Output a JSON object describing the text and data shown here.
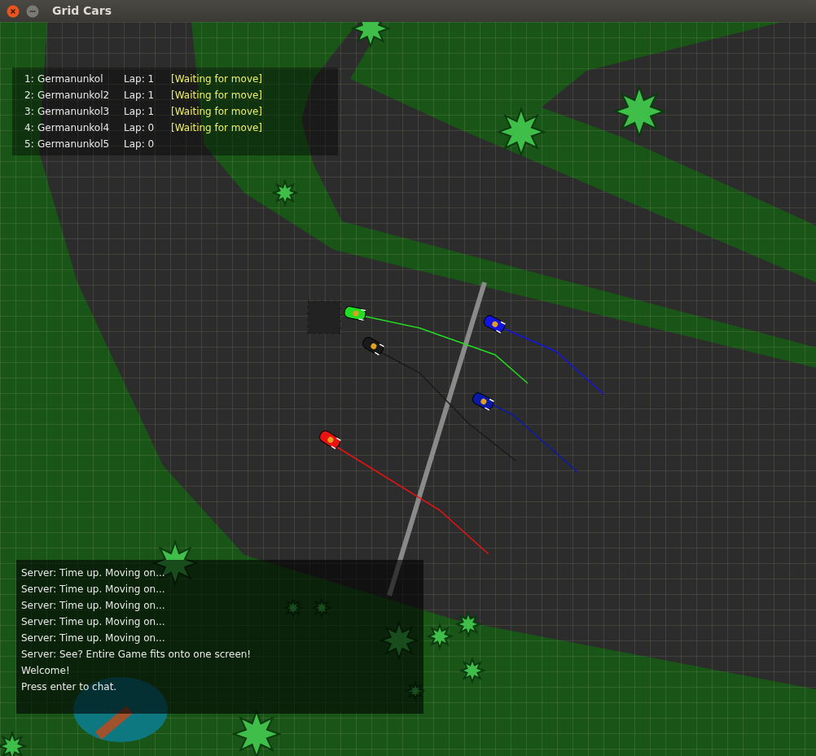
{
  "window": {
    "title": "Grid Cars"
  },
  "scoreboard": [
    {
      "rank": "1:",
      "name": "Germanunkol",
      "lap": "Lap: 1",
      "status": "[Waiting for move]"
    },
    {
      "rank": "2:",
      "name": "Germanunkol2",
      "lap": "Lap: 1",
      "status": "[Waiting for move]"
    },
    {
      "rank": "3:",
      "name": "Germanunkol3",
      "lap": "Lap: 1",
      "status": "[Waiting for move]"
    },
    {
      "rank": "4:",
      "name": "Germanunkol4",
      "lap": "Lap: 0",
      "status": "[Waiting for move]"
    },
    {
      "rank": "5:",
      "name": "Germanunkol5",
      "lap": "Lap: 0"
    }
  ],
  "cars": [
    {
      "color": "#22dd22"
    },
    {
      "color": "#1a1a1a"
    },
    {
      "color": "#1414e0"
    },
    {
      "color": "#0a1aa8"
    },
    {
      "color": "#ee1111"
    }
  ],
  "chat": [
    "Server: Time up. Moving on...",
    "Server: Time up. Moving on...",
    "Server: Time up. Moving on...",
    "Server: Time up. Moving on...",
    "Server: Time up. Moving on...",
    "Server: See? Entire Game fits onto one screen!",
    "Welcome!",
    "Press enter to chat."
  ]
}
